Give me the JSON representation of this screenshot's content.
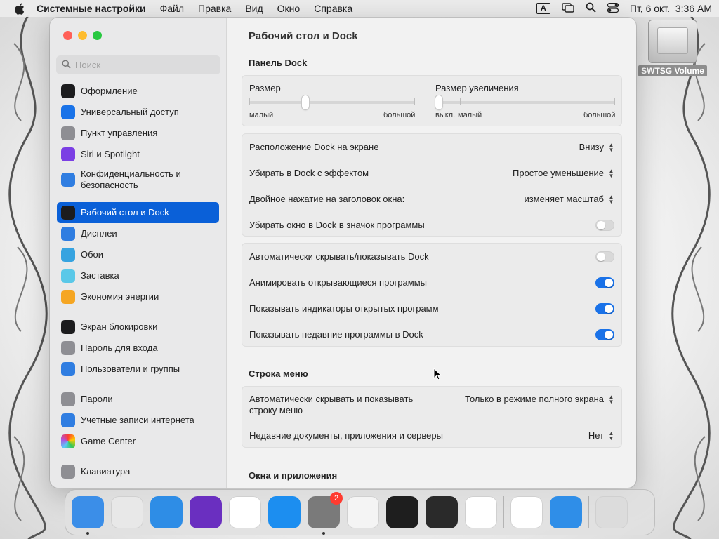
{
  "menubar": {
    "app": "Системные настройки",
    "items": [
      "Файл",
      "Правка",
      "Вид",
      "Окно",
      "Справка"
    ],
    "input_indicator": "A",
    "datetime": "Пт, 6 окт.  3:36 AM"
  },
  "desktop": {
    "drive_label": "SWTSG Volume"
  },
  "sidebar": {
    "search_placeholder": "Поиск",
    "items": [
      {
        "label": "Оформление",
        "icon": "appearance-icon",
        "color": "#1c1c1e"
      },
      {
        "label": "Универсальный доступ",
        "icon": "accessibility-icon",
        "color": "#1a73e8"
      },
      {
        "label": "Пункт управления",
        "icon": "control-center-icon",
        "color": "#8e8e93"
      },
      {
        "label": "Siri и Spotlight",
        "icon": "siri-icon",
        "color": "#7b3fe4"
      },
      {
        "label": "Конфиденциальность и безопасность",
        "icon": "privacy-hand-icon",
        "color": "#2f7de1"
      },
      {
        "label": "Рабочий стол и Dock",
        "icon": "dock-icon",
        "color": "#1c1c1e",
        "active": true
      },
      {
        "label": "Дисплеи",
        "icon": "display-icon",
        "color": "#2f7de1"
      },
      {
        "label": "Обои",
        "icon": "wallpaper-icon",
        "color": "#36a3e0"
      },
      {
        "label": "Заставка",
        "icon": "screensaver-icon",
        "color": "#5ac8e8"
      },
      {
        "label": "Экономия энергии",
        "icon": "battery-icon",
        "color": "#f5a623"
      },
      {
        "label": "Экран блокировки",
        "icon": "lock-screen-icon",
        "color": "#1c1c1e"
      },
      {
        "label": "Пароль для входа",
        "icon": "lock-icon",
        "color": "#8e8e93"
      },
      {
        "label": "Пользователи и группы",
        "icon": "users-icon",
        "color": "#2f7de1"
      },
      {
        "label": "Пароли",
        "icon": "key-icon",
        "color": "#8e8e93"
      },
      {
        "label": "Учетные записи интернета",
        "icon": "at-icon",
        "color": "#2f7de1"
      },
      {
        "label": "Game Center",
        "icon": "game-center-icon",
        "color": "#ffffff"
      },
      {
        "label": "Клавиатура",
        "icon": "keyboard-icon",
        "color": "#8e8e93"
      }
    ]
  },
  "main": {
    "title": "Рабочий стол и Dock",
    "dock_section": "Панель Dock",
    "size_label": "Размер",
    "size_min": "малый",
    "size_max": "большой",
    "size_value": 0.33,
    "magnify_label": "Размер увеличения",
    "magnify_off": "выкл.",
    "magnify_min": "малый",
    "magnify_max": "большой",
    "magnify_value": 0.0,
    "group1": [
      {
        "label": "Расположение Dock на экране",
        "value": "Внизу"
      },
      {
        "label": "Убирать в Dock с эффектом",
        "value": "Простое уменьшение"
      },
      {
        "label": "Двойное нажатие на заголовок окна:",
        "value": "изменяет масштаб"
      },
      {
        "label": "Убирать окно в Dock в значок программы",
        "toggle": false
      }
    ],
    "group2": [
      {
        "label": "Автоматически скрывать/показывать Dock",
        "toggle": false
      },
      {
        "label": "Анимировать открывающиеся программы",
        "toggle": true
      },
      {
        "label": "Показывать индикаторы открытых программ",
        "toggle": true
      },
      {
        "label": "Показывать недавние программы в Dock",
        "toggle": true
      }
    ],
    "menubar_section": "Строка меню",
    "menubar_autohide_label": "Автоматически скрывать и показывать строку меню",
    "menubar_autohide_value": "Только в режиме полного экрана",
    "recent_docs_label": "Недавние документы, приложения и серверы",
    "recent_docs_value": "Нет",
    "windows_section": "Окна и приложения"
  },
  "dock": {
    "apps": [
      {
        "name": "finder-icon",
        "color": "#3b8ee8",
        "running": true
      },
      {
        "name": "launchpad-icon",
        "color": "#e8e8e8"
      },
      {
        "name": "safari-icon",
        "color": "#2e8de6"
      },
      {
        "name": "firefox-icon",
        "color": "#6a2fc0"
      },
      {
        "name": "chrome-icon",
        "color": "#ffffff"
      },
      {
        "name": "app-store-icon",
        "color": "#1c8ef0"
      },
      {
        "name": "system-settings-icon",
        "color": "#7a7a7a",
        "badge": "2",
        "running": true
      },
      {
        "name": "textedit-icon",
        "color": "#f4f4f4"
      },
      {
        "name": "terminal-icon",
        "color": "#1e1e1e"
      },
      {
        "name": "garageband-icon",
        "color": "#2a2a2a"
      },
      {
        "name": "vscode-icon",
        "color": "#ffffff"
      },
      {
        "name": "visual-studio-icon",
        "color": "#ffffff"
      },
      {
        "name": "weather-icon",
        "color": "#2f8ee8"
      },
      {
        "name": "trash-icon",
        "color": "#dcdcdc"
      }
    ]
  }
}
